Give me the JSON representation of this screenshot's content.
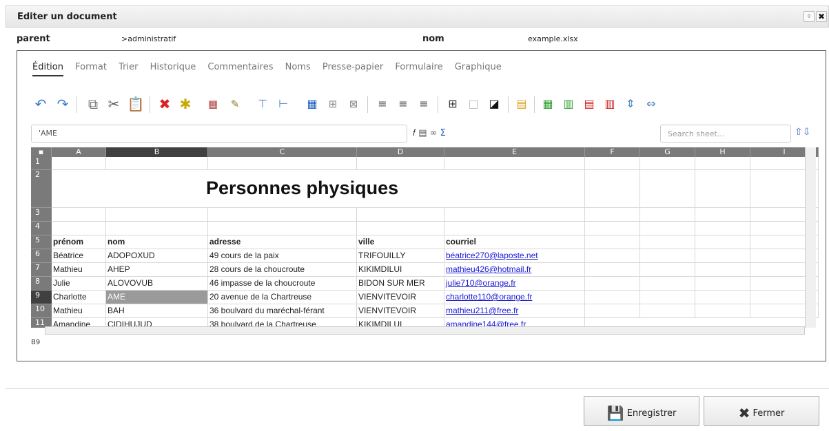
{
  "window": {
    "title": "Editer un document",
    "pin_icon": "pin-icon",
    "close_icon": "close-icon"
  },
  "meta": {
    "parent_label": "parent",
    "parent_value": ">administratif",
    "nom_label": "nom",
    "nom_value": "example.xlsx"
  },
  "tabs": [
    "Édition",
    "Format",
    "Trier",
    "Historique",
    "Commentaires",
    "Noms",
    "Presse-papier",
    "Formulaire",
    "Graphique"
  ],
  "active_tab": "Édition",
  "toolbar_icons": [
    "undo-icon",
    "redo-icon",
    "copy-icon",
    "cut-icon",
    "paste-icon",
    "delete-icon",
    "clear-format-icon",
    "insert-image-icon",
    "edit-icon",
    "insert-row-icon",
    "insert-col-icon",
    "freeze-icon",
    "grid-icon",
    "merge-icon",
    "align-left-icon",
    "align-center-icon",
    "align-right-icon",
    "borders-icon",
    "no-border-icon",
    "fill-color-icon",
    "text-style-icon",
    "add-row-icon",
    "add-col-icon",
    "delete-row-icon",
    "delete-col-icon",
    "row-height-icon",
    "col-width-icon"
  ],
  "formula": {
    "value": "'AME",
    "icons": [
      "function-icon",
      "sheet-icon",
      "link-icon",
      "sum-icon"
    ]
  },
  "search": {
    "placeholder": "Search sheet..."
  },
  "sheet": {
    "columns": [
      "A",
      "B",
      "C",
      "D",
      "E",
      "F",
      "G",
      "H",
      "I"
    ],
    "selected_column": "B",
    "selected_row": "9",
    "rows": [
      "1",
      "2",
      "3",
      "4",
      "5",
      "6",
      "7",
      "8",
      "9",
      "10",
      "11"
    ],
    "title": "Personnes physiques",
    "headers": [
      "prénom",
      "nom",
      "adresse",
      "ville",
      "courriel"
    ],
    "data": [
      [
        "Béatrice",
        "ADOPOXUD",
        "49 cours de la paix",
        "TRIFOUILLY",
        "béatrice270@laposte.net"
      ],
      [
        "Mathieu",
        "AHEP",
        "28 cours de la choucroute",
        "KIKIMDILUI",
        "mathieu426@hotmail.fr"
      ],
      [
        "Julie",
        "ALOVOVUB",
        "46 impasse de la choucroute",
        "BIDON SUR MER",
        "julie710@orange.fr"
      ],
      [
        "Charlotte",
        "AME",
        "20 avenue de la Chartreuse",
        "VIENVITEVOIR",
        "charlotte110@orange.fr"
      ],
      [
        "Mathieu",
        "BAH",
        "36 boulvard du maréchal-férant",
        "VIENVITEVOIR",
        "mathieu211@free.fr"
      ],
      [
        "Amandine",
        "CIDIHUJUD",
        "38 boulvard de la Chartreuse",
        "KIKIMDILUI",
        "amandine144@free.fr"
      ]
    ]
  },
  "status": {
    "cell_ref": "B9"
  },
  "buttons": {
    "save": "Enregistrer",
    "close": "Fermer"
  }
}
